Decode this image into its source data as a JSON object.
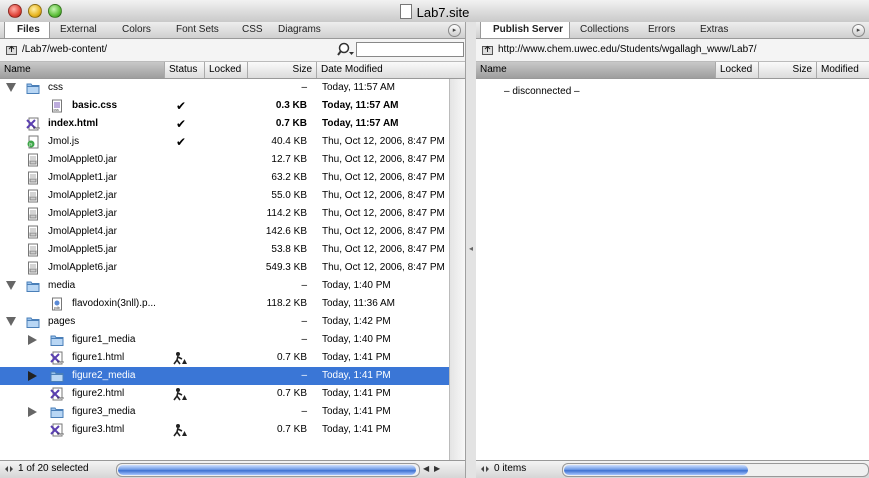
{
  "window": {
    "title": "Lab7.site"
  },
  "left": {
    "tabs": [
      "Files",
      "External",
      "Colors",
      "Font Sets",
      "CSS",
      "Diagrams"
    ],
    "active_tab": "Files",
    "path": "/Lab7/web-content/",
    "search": {
      "value": ""
    },
    "columns": [
      "Name",
      "Status",
      "Locked",
      "Size",
      "Date Modified"
    ],
    "rows": [
      {
        "name": "css",
        "icon": "folder-icon",
        "indent": 0,
        "disclosure": "open",
        "bold": false,
        "status": "",
        "size": "–",
        "date": "Today, 11:57 AM",
        "selected": false
      },
      {
        "name": "basic.css",
        "icon": "css-file-icon",
        "indent": 1,
        "disclosure": "",
        "bold": true,
        "status": "checked",
        "size": "0.3 KB",
        "date": "Today, 11:57 AM",
        "selected": false
      },
      {
        "name": "index.html",
        "icon": "html-file-icon",
        "indent": 0,
        "disclosure": "",
        "bold": true,
        "status": "checked",
        "size": "0.7 KB",
        "date": "Today, 11:57 AM",
        "selected": false
      },
      {
        "name": "Jmol.js",
        "icon": "js-file-icon",
        "indent": 0,
        "disclosure": "",
        "bold": false,
        "status": "checked",
        "size": "40.4 KB",
        "date": "Thu, Oct 12, 2006, 8:47 PM",
        "selected": false
      },
      {
        "name": "JmolApplet0.jar",
        "icon": "jar-file-icon",
        "indent": 0,
        "disclosure": "",
        "bold": false,
        "status": "",
        "size": "12.7 KB",
        "date": "Thu, Oct 12, 2006, 8:47 PM",
        "selected": false
      },
      {
        "name": "JmolApplet1.jar",
        "icon": "jar-file-icon",
        "indent": 0,
        "disclosure": "",
        "bold": false,
        "status": "",
        "size": "63.2 KB",
        "date": "Thu, Oct 12, 2006, 8:47 PM",
        "selected": false
      },
      {
        "name": "JmolApplet2.jar",
        "icon": "jar-file-icon",
        "indent": 0,
        "disclosure": "",
        "bold": false,
        "status": "",
        "size": "55.0 KB",
        "date": "Thu, Oct 12, 2006, 8:47 PM",
        "selected": false
      },
      {
        "name": "JmolApplet3.jar",
        "icon": "jar-file-icon",
        "indent": 0,
        "disclosure": "",
        "bold": false,
        "status": "",
        "size": "114.2 KB",
        "date": "Thu, Oct 12, 2006, 8:47 PM",
        "selected": false
      },
      {
        "name": "JmolApplet4.jar",
        "icon": "jar-file-icon",
        "indent": 0,
        "disclosure": "",
        "bold": false,
        "status": "",
        "size": "142.6 KB",
        "date": "Thu, Oct 12, 2006, 8:47 PM",
        "selected": false
      },
      {
        "name": "JmolApplet5.jar",
        "icon": "jar-file-icon",
        "indent": 0,
        "disclosure": "",
        "bold": false,
        "status": "",
        "size": "53.8 KB",
        "date": "Thu, Oct 12, 2006, 8:47 PM",
        "selected": false
      },
      {
        "name": "JmolApplet6.jar",
        "icon": "jar-file-icon",
        "indent": 0,
        "disclosure": "",
        "bold": false,
        "status": "",
        "size": "549.3 KB",
        "date": "Thu, Oct 12, 2006, 8:47 PM",
        "selected": false
      },
      {
        "name": "media",
        "icon": "folder-icon",
        "indent": 0,
        "disclosure": "open",
        "bold": false,
        "status": "",
        "size": "–",
        "date": "Today, 1:40 PM",
        "selected": false
      },
      {
        "name": "flavodoxin(3nll).p...",
        "icon": "pdb-file-icon",
        "indent": 1,
        "disclosure": "",
        "bold": false,
        "status": "",
        "size": "118.2 KB",
        "date": "Today, 11:36 AM",
        "selected": false
      },
      {
        "name": "pages",
        "icon": "folder-icon",
        "indent": 0,
        "disclosure": "open",
        "bold": false,
        "status": "",
        "size": "–",
        "date": "Today, 1:42 PM",
        "selected": false
      },
      {
        "name": "figure1_media",
        "icon": "folder-icon",
        "indent": 1,
        "disclosure": "closed",
        "bold": false,
        "status": "",
        "size": "–",
        "date": "Today, 1:40 PM",
        "selected": false
      },
      {
        "name": "figure1.html",
        "icon": "html-file-icon",
        "indent": 1,
        "disclosure": "",
        "bold": false,
        "status": "working",
        "size": "0.7 KB",
        "date": "Today, 1:41 PM",
        "selected": false
      },
      {
        "name": "figure2_media",
        "icon": "folder-icon",
        "indent": 1,
        "disclosure": "closed",
        "bold": false,
        "status": "",
        "size": "–",
        "date": "Today, 1:41 PM",
        "selected": true
      },
      {
        "name": "figure2.html",
        "icon": "html-file-icon",
        "indent": 1,
        "disclosure": "",
        "bold": false,
        "status": "working",
        "size": "0.7 KB",
        "date": "Today, 1:41 PM",
        "selected": false
      },
      {
        "name": "figure3_media",
        "icon": "folder-icon",
        "indent": 1,
        "disclosure": "closed",
        "bold": false,
        "status": "",
        "size": "–",
        "date": "Today, 1:41 PM",
        "selected": false
      },
      {
        "name": "figure3.html",
        "icon": "html-file-icon",
        "indent": 1,
        "disclosure": "",
        "bold": false,
        "status": "working",
        "size": "0.7 KB",
        "date": "Today, 1:41 PM",
        "selected": false
      }
    ],
    "status_text": "1 of 20 selected"
  },
  "right": {
    "tabs": [
      "Publish Server",
      "Collections",
      "Errors",
      "Extras"
    ],
    "active_tab": "Publish Server",
    "url": "http://www.chem.uwec.edu/Students/wgallagh_www/Lab7/",
    "columns": [
      "Name",
      "Locked",
      "Size",
      "Modified"
    ],
    "message": "– disconnected –",
    "status_text": "0 items"
  },
  "colors": {
    "selection": "#3a76d6"
  }
}
